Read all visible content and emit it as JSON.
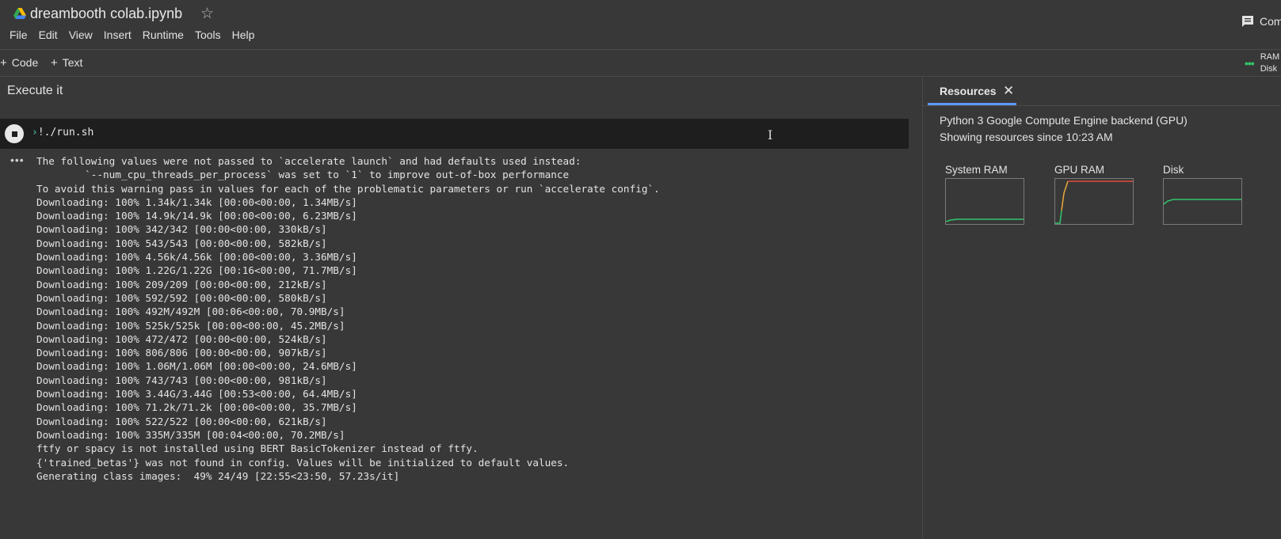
{
  "header": {
    "title": "dreambooth colab.ipynb",
    "comment_label": "Comment"
  },
  "menu": [
    "File",
    "Edit",
    "View",
    "Insert",
    "Runtime",
    "Tools",
    "Help"
  ],
  "toolbar": {
    "code_label": "Code",
    "text_label": "Text",
    "ram_label": "RAM",
    "disk_label": "Disk"
  },
  "notebook": {
    "section_title": "Execute it",
    "cell_code": "!./run.sh",
    "output_lines": [
      "The following values were not passed to `accelerate launch` and had defaults used instead:",
      "        `--num_cpu_threads_per_process` was set to `1` to improve out-of-box performance",
      "To avoid this warning pass in values for each of the problematic parameters or run `accelerate config`.",
      "Downloading: 100% 1.34k/1.34k [00:00<00:00, 1.34MB/s]",
      "Downloading: 100% 14.9k/14.9k [00:00<00:00, 6.23MB/s]",
      "Downloading: 100% 342/342 [00:00<00:00, 330kB/s]",
      "Downloading: 100% 543/543 [00:00<00:00, 582kB/s]",
      "Downloading: 100% 4.56k/4.56k [00:00<00:00, 3.36MB/s]",
      "Downloading: 100% 1.22G/1.22G [00:16<00:00, 71.7MB/s]",
      "Downloading: 100% 209/209 [00:00<00:00, 212kB/s]",
      "Downloading: 100% 592/592 [00:00<00:00, 580kB/s]",
      "Downloading: 100% 492M/492M [00:06<00:00, 70.9MB/s]",
      "Downloading: 100% 525k/525k [00:00<00:00, 45.2MB/s]",
      "Downloading: 100% 472/472 [00:00<00:00, 524kB/s]",
      "Downloading: 100% 806/806 [00:00<00:00, 907kB/s]",
      "Downloading: 100% 1.06M/1.06M [00:00<00:00, 24.6MB/s]",
      "Downloading: 100% 743/743 [00:00<00:00, 981kB/s]",
      "Downloading: 100% 3.44G/3.44G [00:53<00:00, 64.4MB/s]",
      "Downloading: 100% 71.2k/71.2k [00:00<00:00, 35.7MB/s]",
      "Downloading: 100% 522/522 [00:00<00:00, 621kB/s]",
      "Downloading: 100% 335M/335M [00:04<00:00, 70.2MB/s]",
      "ftfy or spacy is not installed using BERT BasicTokenizer instead of ftfy.",
      "{'trained_betas'} was not found in config. Values will be initialized to default values.",
      "Generating class images:  49% 24/49 [22:55<23:50, 57.23s/it]"
    ]
  },
  "resources": {
    "tab_label": "Resources",
    "backend_line": "Python 3 Google Compute Engine backend (GPU)",
    "since_line": "Showing resources since 10:23 AM",
    "gauges": [
      {
        "label": "System RAM",
        "color": "#34c66b"
      },
      {
        "label": "GPU RAM",
        "color": "#e04b3b"
      },
      {
        "label": "Disk",
        "color": "#34c66b"
      }
    ]
  },
  "colors": {
    "background": "#383838",
    "cell_background": "#1e1e1e",
    "accent_blue": "#5b9af8",
    "status_green": "#34c66b"
  }
}
